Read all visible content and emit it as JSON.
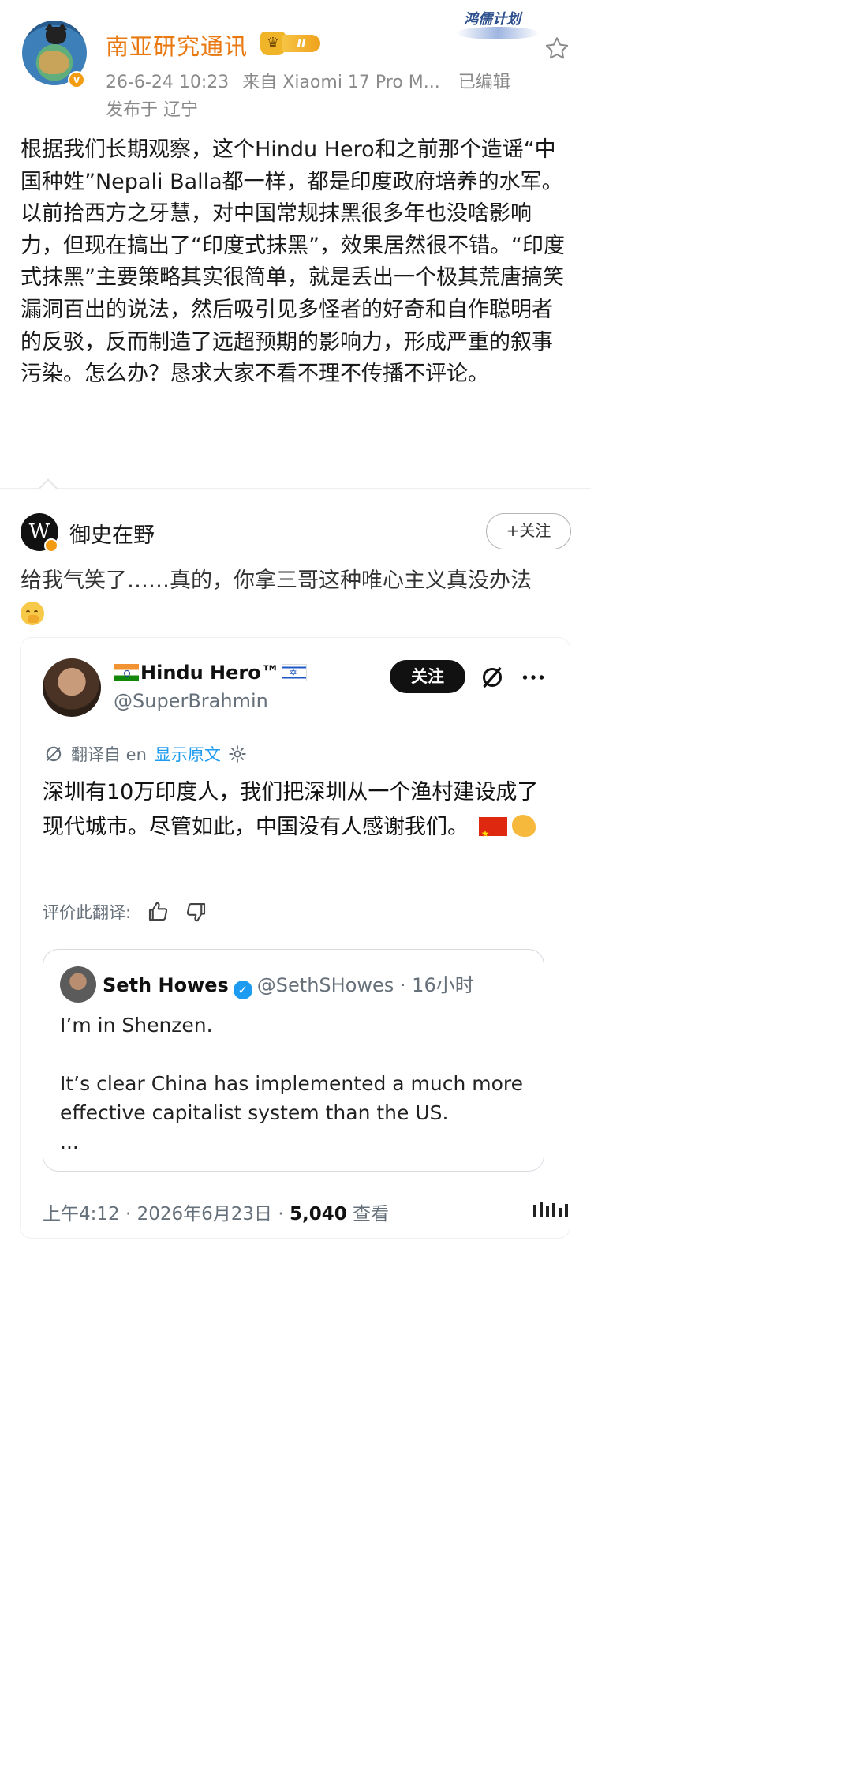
{
  "post": {
    "account_name": "南亚研究通讯",
    "level_badge": "II",
    "verified_mark": "v",
    "avatar_text": "南亚研究通讯",
    "timestamp": "26-6-24 10:23",
    "source": "来自 Xiaomi 17 Pro M...",
    "edited": "已编辑",
    "location": "发布于 辽宁",
    "brand_mark": "鸿儒计划",
    "body": "根据我们长期观察，这个Hindu Hero和之前那个造谣“中国种姓”Nepali Balla都一样，都是印度政府培养的水军。以前拾西方之牙慧，对中国常规抹黑很多年也没啥影响力，但现在搞出了“印度式抹黑”，效果居然很不错。“印度式抹黑”主要策略其实很简单，就是丢出一个极其荒唐搞笑漏洞百出的说法，然后吸引见多怪者的好奇和自作聪明者的反驳，反而制造了远超预期的影响力，形成严重的叙事污染。怎么办？恳求大家不看不理不传播不评论。"
  },
  "comment": {
    "avatar_letter": "W",
    "author": "御史在野",
    "follow_label": "+关注",
    "text": "给我气笑了……真的，你拿三哥这种唯心主义真没办法"
  },
  "tweet": {
    "display_name": "Hindu Hero™",
    "handle": "@SuperBrahmin",
    "follow_label": "关注",
    "translated_from": "翻译自 en",
    "show_original": "显示原文",
    "text": "深圳有10万印度人，我们把深圳从一个渔村建设成了现代城市。尽管如此，中国没有人感谢我们。",
    "rate_label": "评价此翻译:",
    "quote": {
      "name": "Seth Howes",
      "verified_mark": "✓",
      "handle_time": "@SethSHowes · 16小时",
      "line1": "I’m in Shenzen.",
      "line2": "It’s clear China has implemented a much more effective capitalist system than the US.",
      "ellipsis": "..."
    },
    "footer_time": "上午4:12 · 2026年6月23日 · ",
    "views_count": "5,040",
    "views_label": "查看"
  },
  "icons": {
    "star": "star-outline-icon",
    "grok": "grok-icon",
    "more": "more-dots-icon",
    "translate": "translate-icon",
    "settings": "gear-icon",
    "thumbs_up": "thumbs-up-icon",
    "thumbs_down": "thumbs-down-icon"
  },
  "colors": {
    "account_name": "#e8780f",
    "link_blue": "#1d9bf0",
    "meta_gray": "#8a8a8a",
    "verified_orange": "#f39c12"
  }
}
